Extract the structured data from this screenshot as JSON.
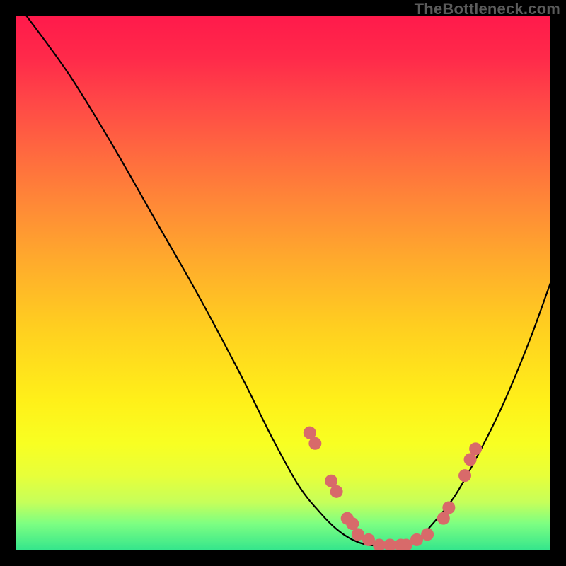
{
  "watermark": "TheBottleneck.com",
  "colors": {
    "background": "#000000",
    "dot": "#d86a6a",
    "curve": "#000000",
    "gradient_top": "#ff1a4b",
    "gradient_bottom": "#33e58c"
  },
  "chart_data": {
    "type": "line",
    "title": "",
    "xlabel": "",
    "ylabel": "",
    "xlim": [
      0,
      100
    ],
    "ylim": [
      0,
      100
    ],
    "grid": false,
    "legend": false,
    "annotations": [
      "TheBottleneck.com"
    ],
    "series": [
      {
        "name": "curve",
        "x": [
          2,
          10,
          18,
          26,
          34,
          42,
          48,
          53,
          57,
          60,
          63,
          66,
          69,
          72,
          75,
          78,
          82,
          86,
          91,
          96,
          100
        ],
        "y": [
          100,
          89,
          76,
          62,
          48,
          33,
          21,
          12,
          7,
          4,
          2,
          1,
          1,
          1,
          2,
          5,
          10,
          17,
          27,
          39,
          50
        ]
      }
    ],
    "highlight_points": [
      {
        "x": 55,
        "y": 22
      },
      {
        "x": 56,
        "y": 20
      },
      {
        "x": 59,
        "y": 13
      },
      {
        "x": 60,
        "y": 11
      },
      {
        "x": 62,
        "y": 6
      },
      {
        "x": 63,
        "y": 5
      },
      {
        "x": 64,
        "y": 3
      },
      {
        "x": 66,
        "y": 2
      },
      {
        "x": 68,
        "y": 1
      },
      {
        "x": 70,
        "y": 1
      },
      {
        "x": 72,
        "y": 1
      },
      {
        "x": 73,
        "y": 1
      },
      {
        "x": 75,
        "y": 2
      },
      {
        "x": 77,
        "y": 3
      },
      {
        "x": 80,
        "y": 6
      },
      {
        "x": 81,
        "y": 8
      },
      {
        "x": 84,
        "y": 14
      },
      {
        "x": 85,
        "y": 17
      },
      {
        "x": 86,
        "y": 19
      }
    ]
  }
}
